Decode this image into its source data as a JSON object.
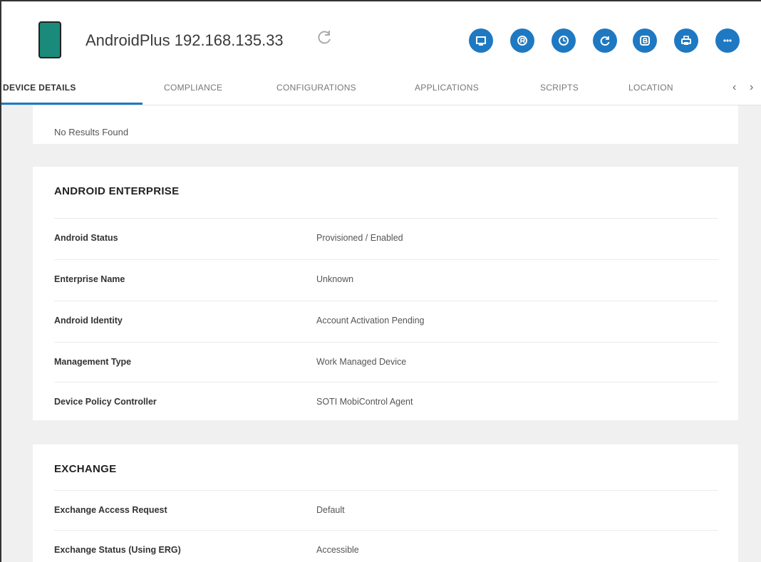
{
  "header": {
    "title": "AndroidPlus 192.168.135.33",
    "refresh_icon": "refresh-icon",
    "actions": [
      {
        "name": "screen-icon"
      },
      {
        "name": "letter-r-icon"
      },
      {
        "name": "clock-icon"
      },
      {
        "name": "refresh-circle-icon"
      },
      {
        "name": "letter-b-icon"
      },
      {
        "name": "printer-icon"
      },
      {
        "name": "more-icon"
      }
    ],
    "accent_color": "#1e79c2",
    "device_color": "#1a8b7a"
  },
  "tabs": {
    "items": [
      "DEVICE DETAILS",
      "COMPLIANCE",
      "CONFIGURATIONS",
      "APPLICATIONS",
      "SCRIPTS",
      "LOCATION"
    ],
    "active": "DEVICE DETAILS",
    "prev_arrow": "‹",
    "next_arrow": "›"
  },
  "top_card": {
    "message": "No Results Found"
  },
  "android_enterprise": {
    "title": "ANDROID ENTERPRISE",
    "rows": [
      {
        "label": "Android Status",
        "value": "Provisioned / Enabled"
      },
      {
        "label": "Enterprise Name",
        "value": "Unknown"
      },
      {
        "label": "Android Identity",
        "value": "Account Activation Pending"
      },
      {
        "label": "Management Type",
        "value": "Work Managed Device"
      },
      {
        "label": "Device Policy Controller",
        "value": "SOTI MobiControl Agent"
      }
    ]
  },
  "exchange": {
    "title": "EXCHANGE",
    "rows": [
      {
        "label": "Exchange Access Request",
        "value": "Default"
      },
      {
        "label": "Exchange Status (Using ERG)",
        "value": "Accessible"
      }
    ]
  }
}
